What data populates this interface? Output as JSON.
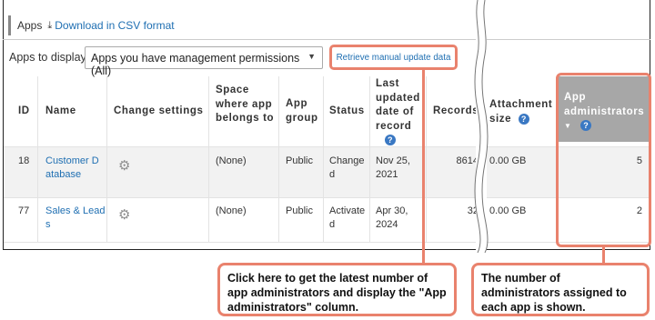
{
  "header": {
    "title": "Apps",
    "download_label": "Download in CSV format"
  },
  "filter": {
    "label": "Apps to display",
    "selected": "Apps you have management permissions (All)",
    "retrieve_label": "Retrieve manual update data"
  },
  "table": {
    "columns": {
      "id": "ID",
      "name": "Name",
      "change_settings": "Change settings",
      "space": "Space where app belongs to",
      "group": "App group",
      "status": "Status",
      "last_updated": "Last updated date of record",
      "records": "Records",
      "attachment": "Attachment size",
      "admins": "App administrators"
    },
    "rows": [
      {
        "id": "18",
        "name": "Customer D atabase",
        "space": "(None)",
        "group": "Public",
        "status": "Change d",
        "last_updated": "Nov 25, 2021",
        "records": "8614",
        "attachment": "0.00 GB",
        "admins": "5"
      },
      {
        "id": "77",
        "name": "Sales & Lead s",
        "space": "(None)",
        "group": "Public",
        "status": "Activate d",
        "last_updated": "Apr 30, 2024",
        "records": "32",
        "attachment": "0.00 GB",
        "admins": "2"
      }
    ]
  },
  "callouts": {
    "left": "Click here to get the latest number of app administrators and display the \"App administrators\" column.",
    "right": "The number of administrators assigned to each app is shown."
  },
  "icons": [
    "download-icon",
    "dropdown-arrow-icon",
    "help-icon",
    "gear-icon",
    "sort-desc-icon"
  ],
  "colors": {
    "accent": "#e9826d",
    "link": "#1f6fb2",
    "help": "#3a78c3",
    "admin_header": "#a7a7a7"
  }
}
